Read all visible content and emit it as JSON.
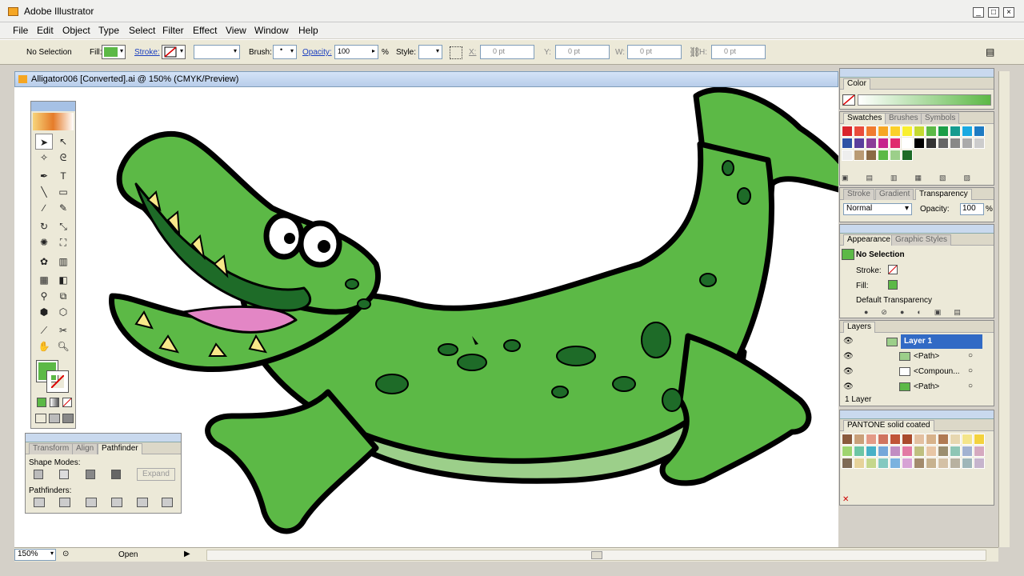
{
  "app": {
    "title": "Adobe Illustrator"
  },
  "menu": [
    "File",
    "Edit",
    "Object",
    "Type",
    "Select",
    "Filter",
    "Effect",
    "View",
    "Window",
    "Help"
  ],
  "control": {
    "selection": "No Selection",
    "fill_label": "Fill:",
    "stroke_label": "Stroke:",
    "brush_label": "Brush:",
    "opacity_label": "Opacity:",
    "opacity_value": "100",
    "percent": "%",
    "style_label": "Style:",
    "x_label": "X:",
    "x_value": "0 pt",
    "y_label": "Y:",
    "y_value": "0 pt",
    "w_label": "W:",
    "w_value": "0 pt",
    "h_label": "H:",
    "h_value": "0 pt"
  },
  "document": {
    "tab_title": "Alligator006 [Converted].ai @ 150% (CMYK/Preview)"
  },
  "status": {
    "zoom": "150%",
    "text": "Open"
  },
  "pathfinder": {
    "tabs": [
      "Transform",
      "Align",
      "Pathfinder"
    ],
    "shape_modes": "Shape Modes:",
    "pathfinders": "Pathfinders:",
    "expand": "Expand"
  },
  "color_panel": {
    "title": "Color"
  },
  "swatches_panel": {
    "tabs": [
      "Swatches",
      "Brushes",
      "Symbols"
    ]
  },
  "transparency_panel": {
    "tabs": [
      "Stroke",
      "Gradient",
      "Transparency"
    ],
    "mode": "Normal",
    "opacity_label": "Opacity:",
    "opacity_value": "100",
    "percent": "%"
  },
  "appearance_panel": {
    "tabs": [
      "Appearance",
      "Graphic Styles"
    ],
    "selection": "No Selection",
    "stroke": "Stroke:",
    "fill": "Fill:",
    "default_transparency": "Default Transparency"
  },
  "layers_panel": {
    "title": "Layers",
    "items": [
      "Layer 1",
      "<Path>",
      "<Compoun...",
      "<Path>"
    ],
    "footer": "1 Layer"
  },
  "pantone_panel": {
    "title": "PANTONE solid coated"
  },
  "colors": {
    "gator": "#5cb946",
    "gator_dark": "#1e6b28",
    "belly": "#9ccf8a",
    "accent": "#316ac5"
  }
}
